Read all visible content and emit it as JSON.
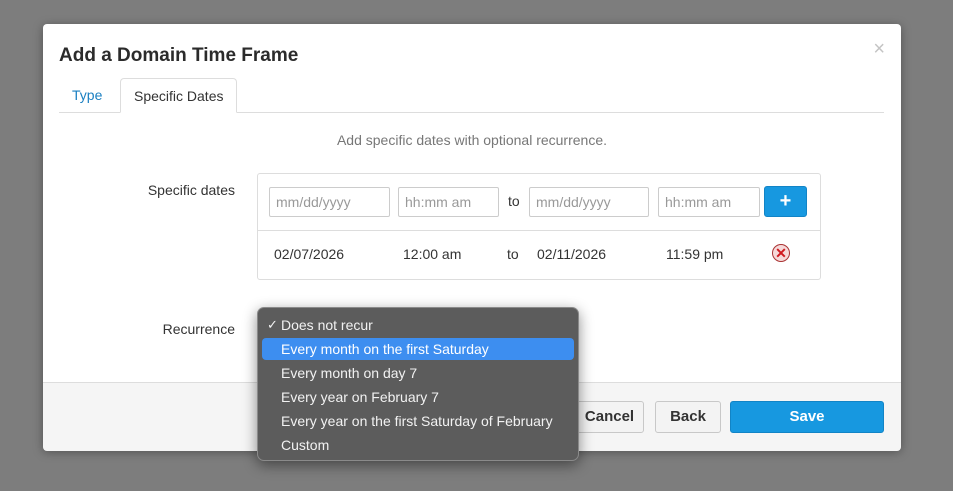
{
  "modal": {
    "title": "Add a Domain Time Frame",
    "close_symbol": "×"
  },
  "tabs": [
    {
      "label": "Type",
      "active": false
    },
    {
      "label": "Specific Dates",
      "active": true
    }
  ],
  "hint": "Add specific dates with optional recurrence.",
  "specific_dates": {
    "label": "Specific dates",
    "start_date_placeholder": "mm/dd/yyyy",
    "start_time_placeholder": "hh:mm am",
    "end_date_placeholder": "mm/dd/yyyy",
    "end_time_placeholder": "hh:mm am",
    "to_label": "to",
    "add_symbol": "+",
    "rows": [
      {
        "start_date": "02/07/2026",
        "start_time": "12:00 am",
        "to": "to",
        "end_date": "02/11/2026",
        "end_time": "11:59 pm",
        "remove_symbol": "✕"
      }
    ]
  },
  "recurrence": {
    "label": "Recurrence",
    "checkmark": "✓",
    "options": [
      "Does not recur",
      "Every month on the first Saturday",
      "Every month on day 7",
      "Every year on February 7",
      "Every year on the first Saturday of February",
      "Custom"
    ],
    "checked_option": "Does not recur",
    "highlighted_option": "Every month on the first Saturday"
  },
  "footer": {
    "cancel_label": "Cancel",
    "back_label": "Back",
    "save_label": "Save"
  },
  "colors": {
    "accent": "#1798e0",
    "highlight": "#3d8ef0",
    "link": "#1a7fc1"
  }
}
